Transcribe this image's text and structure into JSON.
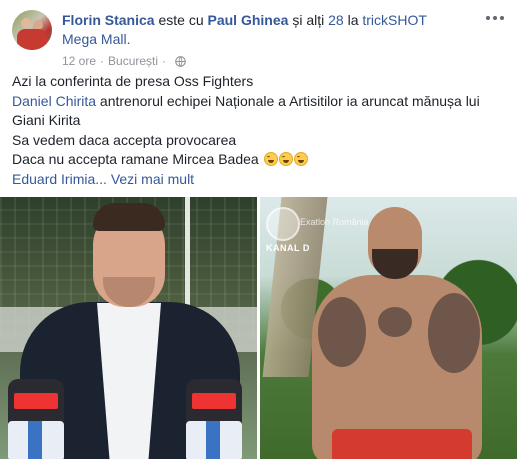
{
  "post": {
    "author": "Florin Stanica",
    "header_connector": "este cu",
    "tagged_name": "Paul Ghinea",
    "header_and": "și alți",
    "others_link": "28",
    "header_at": "la",
    "location": "trickSHOT Mega Mall.",
    "time": "12 ore",
    "city": "București",
    "privacy_icon": "globe-icon",
    "menu_icon": "more-options-icon",
    "lines": {
      "line1": "Azi la conferinta de presa Oss Fighters",
      "line2_link": "Daniel Chirita",
      "line2_rest": " antrenorul echipei Naționale a Artisitilor ia aruncat mănușa lui Giani Kirita",
      "line3": "Sa vedem daca accepta provocarea",
      "line4": "Daca nu accepta ramane Mircea Badea ",
      "line5_link": "Eduard Irimia",
      "more_link": "... Vezi mai mult"
    },
    "emoji_icon": "laughing-tears-emoji",
    "photo_right_channel": "KANAL D",
    "photo_right_watermark": "Exatlon România"
  }
}
